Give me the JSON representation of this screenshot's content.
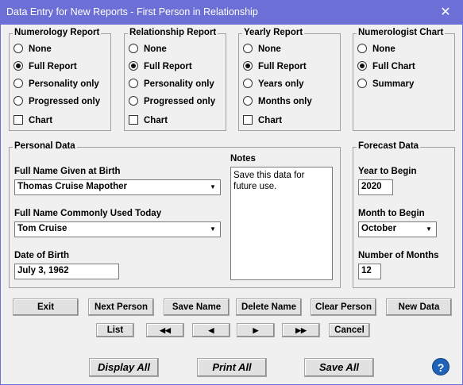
{
  "window": {
    "title": "Data Entry for New Reports - First Person in Relationship",
    "close_glyph": "✕"
  },
  "groups": {
    "numerology": {
      "title": "Numerology Report",
      "options": [
        "None",
        "Full Report",
        "Personality only",
        "Progressed only"
      ],
      "selected": "Full Report",
      "chart_label": "Chart"
    },
    "relationship": {
      "title": "Relationship Report",
      "options": [
        "None",
        "Full Report",
        "Personality only",
        "Progressed only"
      ],
      "selected": "Full Report",
      "chart_label": "Chart"
    },
    "yearly": {
      "title": "Yearly Report",
      "options": [
        "None",
        "Full Report",
        "Years only",
        "Months only"
      ],
      "selected": "Full Report",
      "chart_label": "Chart"
    },
    "numerologist_chart": {
      "title": "Numerologist Chart",
      "options": [
        "None",
        "Full Chart",
        "Summary"
      ],
      "selected": "Full Chart"
    }
  },
  "personal": {
    "title": "Personal Data",
    "birth_name_label": "Full Name Given at Birth",
    "birth_name_value": "Thomas Cruise Mapother",
    "common_name_label": "Full Name Commonly Used Today",
    "common_name_value": "Tom Cruise",
    "dob_label": "Date of Birth",
    "dob_value": "July 3, 1962",
    "notes_label": "Notes",
    "notes_value": "Save this data for future use."
  },
  "forecast": {
    "title": "Forecast Data",
    "year_label": "Year to Begin",
    "year_value": "2020",
    "month_label": "Month to Begin",
    "month_value": "October",
    "months_label": "Number of Months",
    "months_value": "12"
  },
  "buttons": {
    "exit": "Exit",
    "next_person": "Next Person",
    "save_name": "Save Name",
    "delete_name": "Delete Name",
    "clear_person": "Clear Person",
    "new_data": "New Data",
    "list": "List",
    "first": "◀◀",
    "prev": "◀",
    "next": "▶",
    "last": "▶▶",
    "cancel": "Cancel",
    "display_all": "Display All",
    "print_all": "Print All",
    "save_all": "Save All",
    "help": "?"
  },
  "icons": {
    "close": "close-icon",
    "help": "help-icon",
    "dropdown": "chevron-down-icon"
  }
}
